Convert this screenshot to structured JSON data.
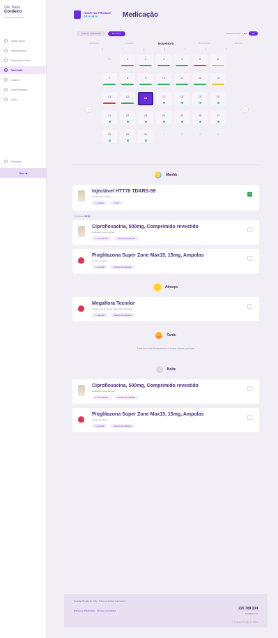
{
  "user": {
    "greeting": "Olá, Maria",
    "name": "Cordeiro",
    "subtitle": "Seu perfil de paciente"
  },
  "sidebar": {
    "items": [
      {
        "label": "Cartão Virtual",
        "icon": "card-icon"
      },
      {
        "label": "Agendamentos",
        "icon": "calendar-icon"
      },
      {
        "label": "Atendimento Online",
        "icon": "video-icon"
      },
      {
        "label": "Medicação",
        "icon": "pill-icon",
        "active": true
      },
      {
        "label": "Exames",
        "icon": "flask-icon"
      },
      {
        "label": "Dados Pessoais",
        "icon": "user-icon"
      },
      {
        "label": "Ajuda",
        "icon": "help-icon"
      }
    ],
    "settings": "Definições",
    "logout": "Sair"
  },
  "header": {
    "brand_top": "HOSPITAL PRIVADO",
    "brand_bottom": "DE PORTO",
    "title": "Medicação"
  },
  "filters": {
    "all": "Todas as medicações",
    "selected": "Em curso",
    "label": "Selecionar data",
    "link": "Hoje",
    "button": "Ver"
  },
  "calendar": {
    "months": [
      "Setembro",
      "Outubro",
      "Novembro",
      "Dezembro",
      "Janeiro"
    ],
    "current_index": 2,
    "weekdays": [
      "S",
      "T",
      "Q",
      "Q",
      "S",
      "S",
      "D"
    ],
    "days": [
      {
        "n": "31",
        "empty": true
      },
      {
        "n": "1",
        "bar": "g"
      },
      {
        "n": "2",
        "bar": "g"
      },
      {
        "n": "3",
        "bar": "g"
      },
      {
        "n": "4",
        "bar": "g"
      },
      {
        "n": "5",
        "bar": "r"
      },
      {
        "n": "6",
        "bar": "y"
      },
      {
        "n": "7",
        "bar": "g"
      },
      {
        "n": "8",
        "bar": "g"
      },
      {
        "n": "9",
        "bar": "g"
      },
      {
        "n": "10",
        "bar": "g"
      },
      {
        "n": "11",
        "bar": "g"
      },
      {
        "n": "12",
        "bar": "g"
      },
      {
        "n": "13",
        "bar": "y"
      },
      {
        "n": "14",
        "bar": "r"
      },
      {
        "n": "15",
        "bar": "g"
      },
      {
        "n": "16",
        "today": true
      },
      {
        "n": "17",
        "dot": true
      },
      {
        "n": "18",
        "dot": true
      },
      {
        "n": "19",
        "dot": true
      },
      {
        "n": "20",
        "dot": true
      },
      {
        "n": "21",
        "dot": true
      },
      {
        "n": "22",
        "dot": true
      },
      {
        "n": "23",
        "dot": true
      },
      {
        "n": "24",
        "dot": true
      },
      {
        "n": "25",
        "dot": true
      },
      {
        "n": "26",
        "dot": true
      },
      {
        "n": "27",
        "dot": true
      },
      {
        "n": "28",
        "dot": true
      },
      {
        "n": "29",
        "dot": true
      },
      {
        "n": "30",
        "dot": true
      },
      {
        "n": "1",
        "empty": true
      },
      {
        "n": "2",
        "empty": true
      },
      {
        "n": "3",
        "empty": true
      },
      {
        "n": "4",
        "empty": true
      }
    ]
  },
  "sections": {
    "manha": "Manhã",
    "almoco": "Almoço",
    "tarde": "Tarde",
    "noite": "Noite",
    "tarde_empty": "Não tem medicamentos a tomar neste período"
  },
  "meds": {
    "m1": {
      "name": "Injectável HTT78 TDARS-59",
      "desc": "Tomar após refeição",
      "tag1": "1 injeção",
      "tag2": "7 dias"
    },
    "taken_note": "Tomado às",
    "taken_time": "08:00",
    "m2": {
      "name": "Ciprofloxacina, 500mg, Comprimido revestido",
      "desc": "Antibiótico para infeções",
      "tag1": "1 comprimido",
      "tag2": "Depois da refeição"
    },
    "m3": {
      "name": "Pioglitazona Super Zone Max15, 15mg, Ampolas",
      "desc": "Tomar com água",
      "tag1": "1 ampola",
      "tag2": "Depois da refeição"
    },
    "m4": {
      "name": "Megaflora Tecnilor",
      "desc": "Suplemento alimentar para a flora intestinal",
      "tag1": "1 cápsula",
      "tag2": "Depois da refeição"
    },
    "m5": {
      "name": "Ciprofloxacina, 500mg, Comprimido revestido",
      "desc": "Antibiótico para infeções",
      "tag1": "1 comprimido",
      "tag2": "Depois da refeição"
    },
    "m6": {
      "name": "Pioglitazona Super Zone Max15, 15mg, Ampolas",
      "desc": "Tomar com água",
      "tag1": "1 ampola",
      "tag2": "Depois da refeição"
    }
  },
  "footer": {
    "text": "Hospital Privado de Porto. Todos os direitos reservados.",
    "links": "Política de Privacidade · Termos e Condições",
    "phone": "220 789 100",
    "call": "Contacte-nos",
    "copy": "© Hospital Privado de Porto"
  },
  "colors": {
    "accent": "#6c2bd9",
    "ok": "#2fa85a",
    "warn": "#e8c22b",
    "error": "#d13b3b",
    "info": "#3db8d9"
  }
}
